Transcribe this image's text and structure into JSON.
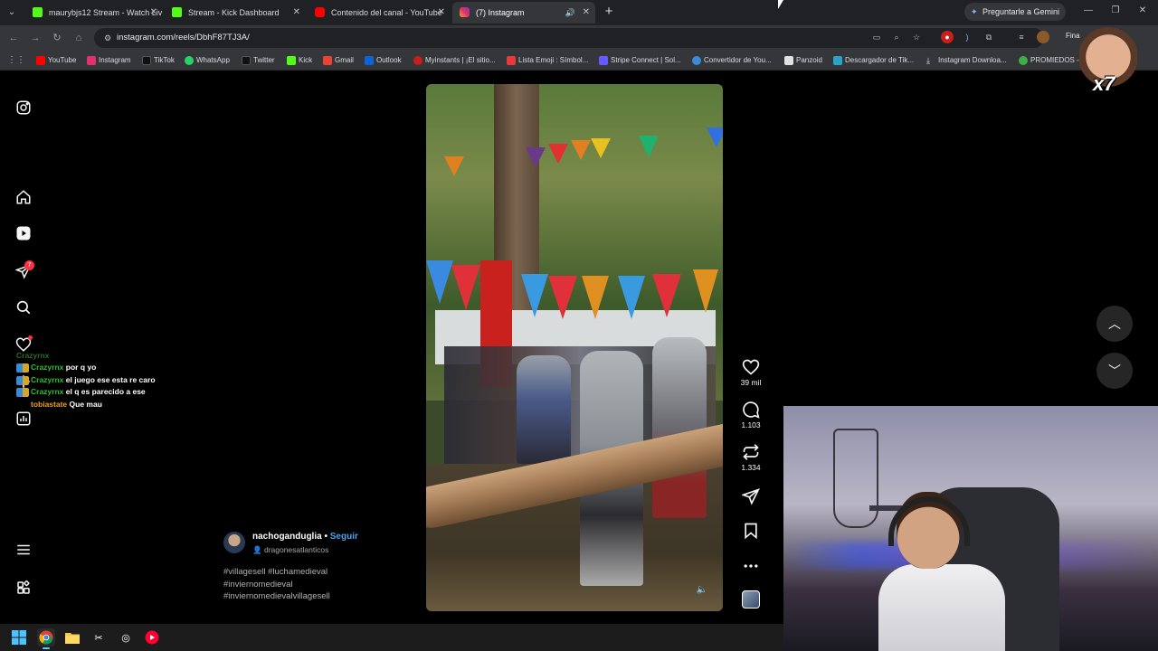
{
  "browser": {
    "tabs": [
      {
        "title": "maurybjs12 Stream - Watch Liv",
        "favicon_color": "#53fc18"
      },
      {
        "title": "Stream - Kick Dashboard",
        "favicon_color": "#53fc18"
      },
      {
        "title": "Contenido del canal - YouTube",
        "favicon_color": "#ff0000"
      },
      {
        "title": "(7) Instagram",
        "favicon_color": "#e1306c"
      }
    ],
    "gemini_label": "Preguntarle a Gemini",
    "url": "instagram.com/reels/DbhF87TJ3A/",
    "profile_label": "Fina",
    "bookmarks": [
      {
        "label": "YouTube",
        "color": "#ff0000"
      },
      {
        "label": "Instagram",
        "color": "#e1306c"
      },
      {
        "label": "TikTok",
        "color": "#111111"
      },
      {
        "label": "WhatsApp",
        "color": "#25d366"
      },
      {
        "label": "Twitter",
        "color": "#111111"
      },
      {
        "label": "Kick",
        "color": "#53fc18"
      },
      {
        "label": "Gmail",
        "color": "#ea4335"
      },
      {
        "label": "Outlook",
        "color": "#0a64d6"
      },
      {
        "label": "Myinstants | ¡El sitio...",
        "color": "#c81e1e"
      },
      {
        "label": "Lista Emoji : Símbol...",
        "color": "#e83a3a"
      },
      {
        "label": "Stripe Connect | Sol...",
        "color": "#635bff"
      },
      {
        "label": "Convertidor de You...",
        "color": "#3a8ad8"
      },
      {
        "label": "Panzoid",
        "color": "#e0e0e0"
      },
      {
        "label": "Descargador de Tik...",
        "color": "#2aa3c9"
      },
      {
        "label": "Instagram Downloa...",
        "color": "#e0e0e0"
      },
      {
        "label": "PROMIEDOS - F",
        "color": "#3cb043"
      }
    ]
  },
  "instagram": {
    "notifications_count": "7",
    "reel": {
      "author": "nachoganduglia",
      "follow_label": "Seguir",
      "separator": "•",
      "audio": "dragonesatlanticos",
      "hashtags": [
        "#villagesell #luchamedieval",
        "#inviernomedieval",
        "#inviernomedievalvillagesell"
      ],
      "likes": "39 mil",
      "comments": "1.103",
      "reposts": "1.334"
    }
  },
  "stream_overlay": {
    "chat_faded": "Crazyrnx",
    "chat": [
      {
        "user": "Crazyrnx",
        "message": "por q yo",
        "color": "#2fbf2f"
      },
      {
        "user": "Crazyrnx",
        "message": "el juego ese esta re caro",
        "color": "#2fbf2f"
      },
      {
        "user": "Crazyrnx",
        "message": "el q es parecido a ese",
        "color": "#2fbf2f"
      },
      {
        "user": "tobiastate",
        "message": "Que mau",
        "color": "#f0a020"
      }
    ],
    "emote_multiplier": "x7"
  }
}
